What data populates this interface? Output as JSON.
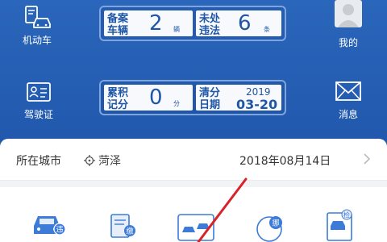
{
  "left_nav": [
    {
      "label": "机动车",
      "icon": "car-list-icon"
    },
    {
      "label": "驾驶证",
      "icon": "license-card-icon"
    }
  ],
  "right_nav": [
    {
      "label": "我的",
      "icon": "avatar-icon"
    },
    {
      "label": "消息",
      "icon": "envelope-icon"
    }
  ],
  "vehicle_panel": {
    "left_label_1": "备案",
    "left_label_2": "车辆",
    "left_value": "2",
    "left_unit": "辆",
    "right_label_1": "未处",
    "right_label_2": "违法",
    "right_value": "6",
    "right_unit": "条"
  },
  "score_panel": {
    "left_label_1": "累积",
    "left_label_2": "记分",
    "left_value": "0",
    "left_unit": "分",
    "right_label_1": "清分",
    "right_label_2": "日期",
    "year": "2019",
    "date": "03-20"
  },
  "city": {
    "label": "所在城市",
    "location": "菏泽",
    "date": "2018年08月14日"
  },
  "services": [
    {
      "icon": "car-violation-icon",
      "badge": "违"
    },
    {
      "icon": "scroll-payment-icon",
      "badge": "缴"
    },
    {
      "icon": "cars-accident-icon",
      "badge": ""
    },
    {
      "icon": "car-move-icon",
      "badge": "挪"
    },
    {
      "icon": "car-inspection-icon",
      "badge": "检"
    }
  ],
  "colors": {
    "header_blue": "#2460b4",
    "panel_text": "#1f56a6",
    "annotation_red": "#d8232a"
  }
}
